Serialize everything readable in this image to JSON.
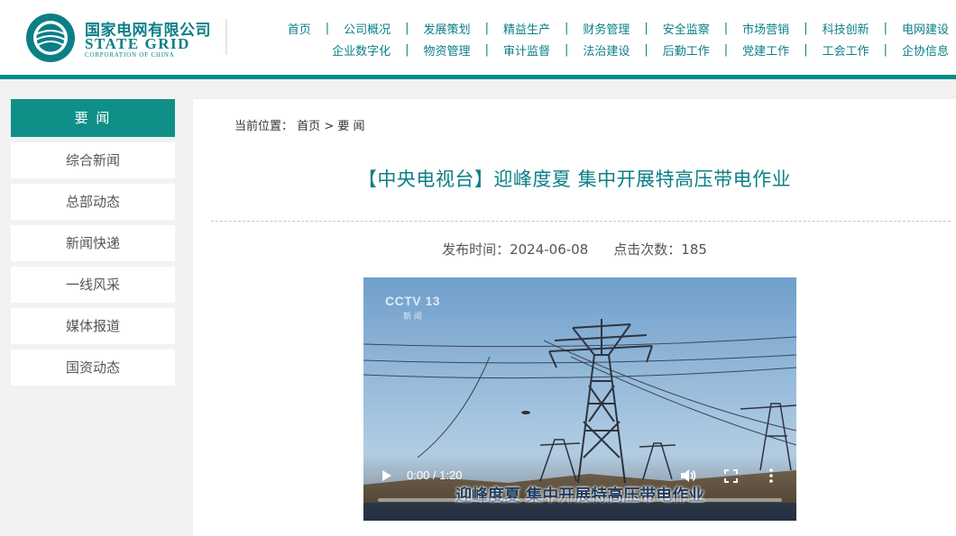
{
  "logo": {
    "cn": "国家电网有限公司",
    "en": "STATE GRID",
    "en_sub": "CORPORATION OF CHINA"
  },
  "nav": {
    "row1": [
      "首页",
      "公司概况",
      "发展策划",
      "精益生产",
      "财务管理",
      "安全监察",
      "市场营销",
      "科技创新",
      "电网建设"
    ],
    "row2": [
      "企业数字化",
      "物资管理",
      "审计监督",
      "法治建设",
      "后勤工作",
      "党建工作",
      "工会工作",
      "企协信息"
    ]
  },
  "sidebar": {
    "title": "要 闻",
    "items": [
      {
        "label": "综合新闻"
      },
      {
        "label": "总部动态"
      },
      {
        "label": "新闻快递"
      },
      {
        "label": "一线风采"
      },
      {
        "label": "媒体报道"
      },
      {
        "label": "国资动态"
      }
    ]
  },
  "breadcrumb": {
    "prefix": "当前位置：",
    "home": "首页",
    "sep": ">",
    "current": "要 闻"
  },
  "article": {
    "title": "【中央电视台】迎峰度夏 集中开展特高压带电作业",
    "publish_label": "发布时间：",
    "publish_date": "2024-06-08",
    "clicks_label": "点击次数：",
    "clicks": "185"
  },
  "video": {
    "channel_logo": "CCTV 13",
    "channel_sub": "新 闻",
    "caption": "迎峰度夏 集中开展特高压带电作业",
    "time": "0:00 / 1:20",
    "play_icon": "play-icon",
    "volume_icon": "volume-icon",
    "fullscreen_icon": "fullscreen-icon",
    "more_icon": "more-vertical-icon"
  },
  "colors": {
    "accent": "#0b7f86",
    "sidebar_active": "#0f8f88"
  }
}
